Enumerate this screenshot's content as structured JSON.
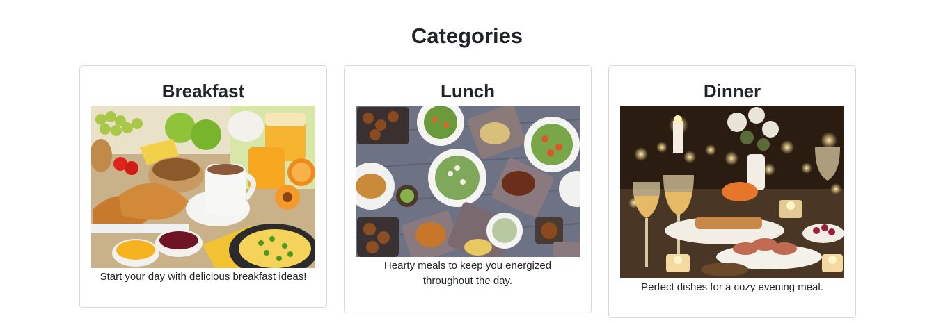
{
  "page": {
    "title": "Categories"
  },
  "categories": [
    {
      "title": "Breakfast",
      "description": "Start your day with delicious breakfast ideas!",
      "image_subject": "breakfast spread with croissants, coffee, orange juice and fruit"
    },
    {
      "title": "Lunch",
      "description": "Hearty meals to keep you energized throughout the day.",
      "image_subject": "overhead view of assorted lunch dishes on a grey wooden table"
    },
    {
      "title": "Dinner",
      "description": "Perfect dishes for a cozy evening meal.",
      "image_subject": "candlelit dinner table with wine glasses and plated meat"
    }
  ],
  "colors": {
    "text": "#212529",
    "card_border": "#d6d8db",
    "background": "#ffffff"
  }
}
